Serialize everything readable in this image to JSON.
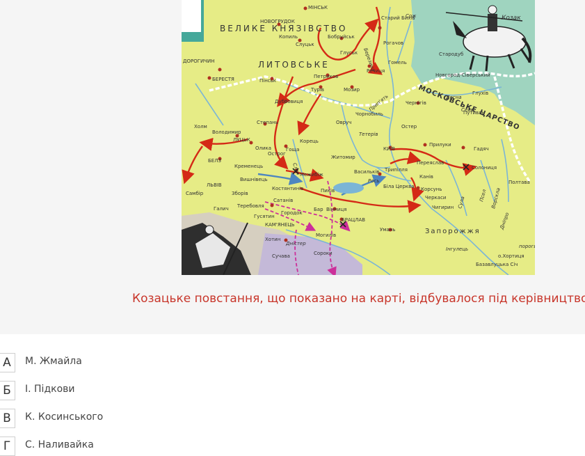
{
  "map": {
    "labels": {
      "grand_duchy_1": "ВЕЛИКЕ  КНЯЗІВСТВО",
      "grand_duchy_2": "ЛИТОВСЬКЕ",
      "muscovy": "МОСКОВСЬКЕ ЦАРСТВО",
      "kozak": "Козак",
      "zaporozhia": "Запорожжя",
      "minsk": "МІНСЬК",
      "novogrudok": "НОВОГРУДОК",
      "slutsk": "Слуцьк",
      "kopyl": "Копиль",
      "bobruisk": "Бобруйськ",
      "glusk": "Глуськ",
      "stary_bykhiv": "Старий Бихів",
      "rogachev": "Рогачов",
      "rechytsa": "Речиця",
      "gomel": "Гомель",
      "starodub": "Стародуб",
      "novgorod_siversky": "Новгород-Сіверський",
      "drohichyn": "ДОРОГИЧИН",
      "berestia": "БЕРЕСТЯ",
      "pinsk": "Пінськ",
      "petrykov": "Петриков",
      "turov": "Турів",
      "mozyr": "Мозир",
      "chernihiv": "Чернігів",
      "hlukhiv": "Глухів",
      "putyvl": "Путивль",
      "dubrovytsia": "Дубровиця",
      "chornobyl": "Чорнобиль",
      "ovruch": "Овруч",
      "oster": "Остер",
      "stepan": "Степань",
      "volodymyr": "Володимир",
      "lutsk": "ЛУЦЬК",
      "olyka": "Олика",
      "ostroh": "Острог",
      "hoshcha": "Гоща",
      "korets": "Корець",
      "zhytomyr": "Житомир",
      "kyiv": "КИЇВ",
      "pryluky": "Прилуки",
      "hadiach": "Гадяч",
      "pereiaslav": "Переяслав",
      "solonytsia": "Солониця",
      "kholm": "Холм",
      "belz": "БЕЛЗ",
      "kremenets": "Кременець",
      "mezhybizh": "Межибіж",
      "vasylkiv": "Васильків",
      "trypillia": "Трипілля",
      "kaniv": "Канів",
      "lviv": "ЛЬВІВ",
      "vyshnivets": "Вишнівець",
      "kostiantyniv": "Костянтинів",
      "pyliava": "Пиків",
      "bila_tserkva": "Біла Церква",
      "korsun": "Корсунь",
      "cherkasy": "Черкаси",
      "poltava": "Полтава",
      "sambir": "Самбір",
      "zboriv": "Зборів",
      "terebovlia": "Теребовля",
      "satanov": "Сатанів",
      "bar": "Бар",
      "vinnytsia": "Вінниця",
      "bratslav": "БРАЦЛАВ",
      "halych": "Галич",
      "husiatyn": "Гусятин",
      "horodok": "Городок",
      "kamianets": "КАМ'ЯНЕЦЬ",
      "chyhyryn": "Чигирин",
      "uman": "Умань",
      "khotyn": "Хотин",
      "mohyliv": "Могилів",
      "soroky": "Сороки",
      "suchava": "Сучава",
      "khortytsia": "о.Хортиця",
      "bazavluk": "Базавлуцька Січ",
      "river_dnipro": "Дніпро",
      "river_desna": "Десна",
      "river_sozh": "Сож",
      "river_berezyna": "Березина",
      "river_prypiat": "Прип'ять",
      "river_teteriv": "Тетерів",
      "river_ros": "Рось",
      "river_vorskla": "Ворскла",
      "river_psel": "Псел",
      "river_sula": "Сула",
      "river_seim": "Сейм",
      "river_sluch": "Случ",
      "river_dnister": "Дністер",
      "river_ingul": "Інгулець",
      "rapids": "пороги"
    }
  },
  "question": {
    "text": "Козацьке повстання, що показано на карті, відбувалося під керівництвом:"
  },
  "answers": [
    {
      "letter": "А",
      "text": "М. Жмайла"
    },
    {
      "letter": "Б",
      "text": "І. Підкови"
    },
    {
      "letter": "В",
      "text": "К. Косинського"
    },
    {
      "letter": "Г",
      "text": "С. Наливайка"
    }
  ],
  "colors": {
    "question": "#c8362b",
    "map_land": "#e6ec86",
    "muscovy_land": "#9fd4bf",
    "water": "#7bb5d6",
    "route": "#d42a16",
    "route_alt": "#cc2f9a",
    "route_blue": "#4d86c0",
    "border": "#ffffff"
  }
}
